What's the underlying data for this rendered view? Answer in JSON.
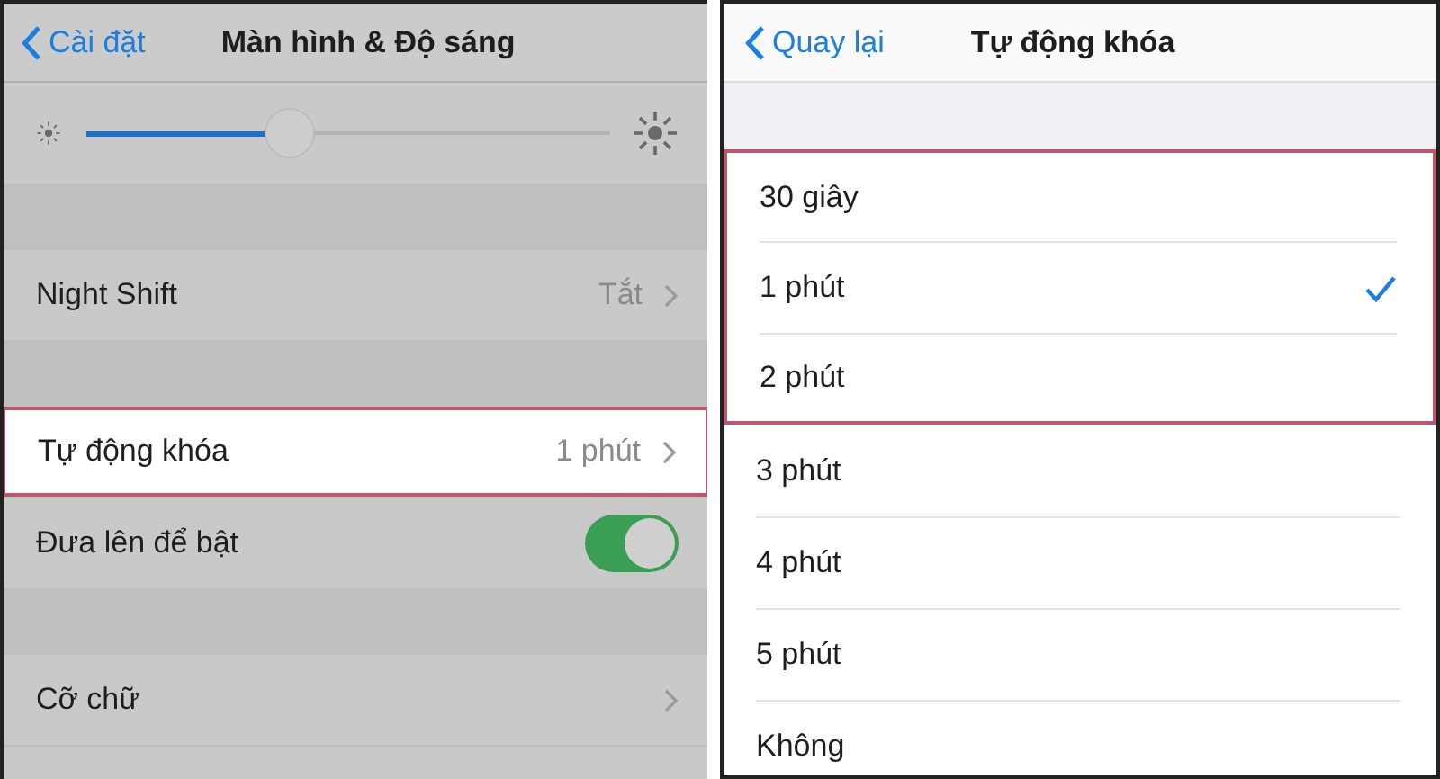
{
  "left": {
    "nav": {
      "back": "Cài đặt",
      "title": "Màn hình & Độ sáng"
    },
    "brightness": {
      "level": 0.39
    },
    "groups": [
      [
        {
          "kind": "value",
          "label": "Night Shift",
          "value": "Tắt",
          "highlighted": false
        }
      ],
      [
        {
          "kind": "value",
          "label": "Tự động khóa",
          "value": "1 phút",
          "highlighted": true
        },
        {
          "kind": "toggle",
          "label": "Đưa lên để bật",
          "on": true,
          "highlighted": false
        }
      ],
      [
        {
          "kind": "value",
          "label": "Cỡ chữ",
          "highlighted": false
        }
      ]
    ]
  },
  "right": {
    "nav": {
      "back": "Quay lại",
      "title": "Tự động khóa"
    },
    "options": [
      {
        "label": "30 giây",
        "selected": false,
        "highlighted": true
      },
      {
        "label": "1 phút",
        "selected": true,
        "highlighted": true
      },
      {
        "label": "2 phút",
        "selected": false,
        "highlighted": true
      },
      {
        "label": "3 phút",
        "selected": false,
        "highlighted": false
      },
      {
        "label": "4 phút",
        "selected": false,
        "highlighted": false
      },
      {
        "label": "5 phút",
        "selected": false,
        "highlighted": false
      },
      {
        "label": "Không",
        "selected": false,
        "highlighted": false
      }
    ]
  }
}
